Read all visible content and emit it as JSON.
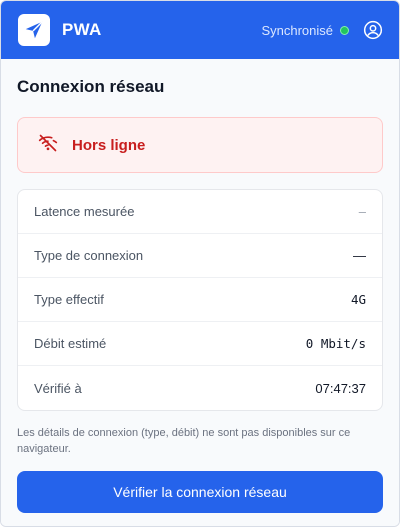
{
  "header": {
    "app_name": "PWA",
    "sync_status": "Synchronisé",
    "sync_color": "#22c55e",
    "brand_color": "#2563eb",
    "logo_icon": "paper-plane-icon",
    "account_icon": "user-circle-icon"
  },
  "main": {
    "title": "Connexion réseau",
    "status": {
      "label": "Hors ligne",
      "icon": "wifi-off-icon",
      "color": "#c81e1e"
    },
    "details": [
      {
        "label": "Latence mesurée",
        "value": "–"
      },
      {
        "label": "Type de connexion",
        "value": "—"
      },
      {
        "label": "Type effectif",
        "value": "4G"
      },
      {
        "label": "Débit estimé",
        "value": "0 Mbit/s"
      },
      {
        "label": "Vérifié à",
        "value": "07:47:37"
      }
    ],
    "note": "Les détails de connexion (type, débit) ne sont pas disponibles sur ce navigateur.",
    "check_button_label": "Vérifier la connexion réseau"
  }
}
